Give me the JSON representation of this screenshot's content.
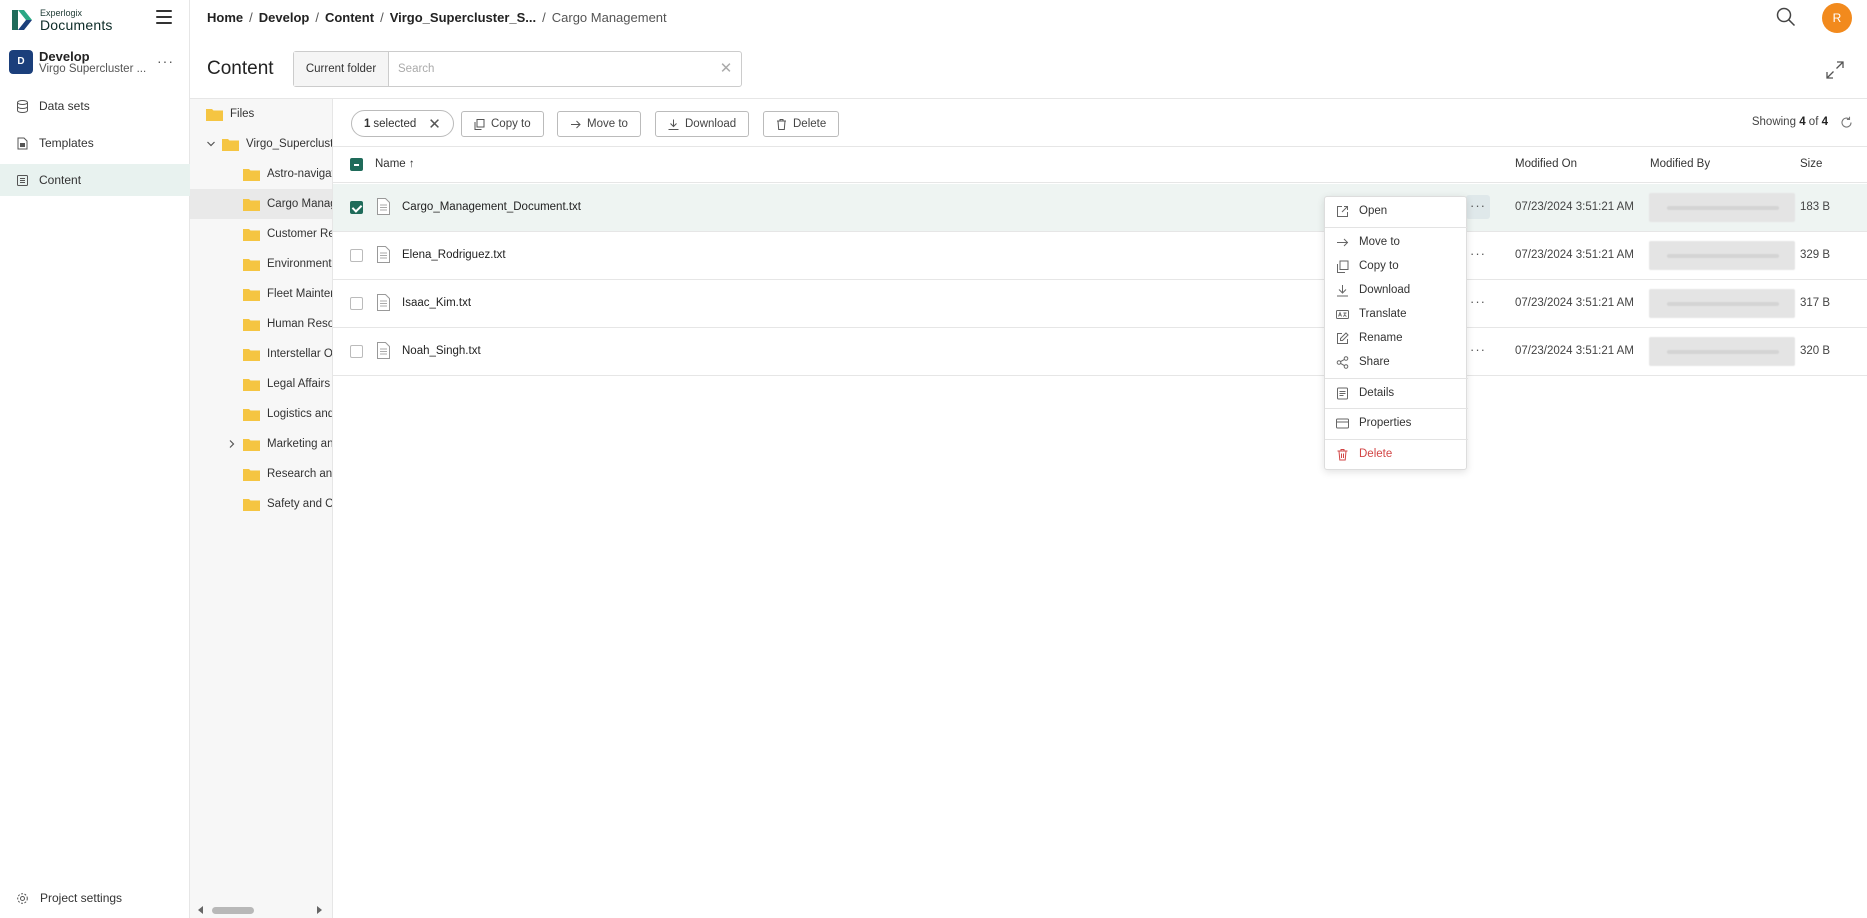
{
  "brand": {
    "small": "Experlogix",
    "big": "Documents",
    "color": "#0c2b27"
  },
  "project": {
    "avatar": "D",
    "name": "Develop",
    "sub": "Virgo Supercluster ...",
    "more": "···"
  },
  "nav": [
    {
      "label": "Data sets",
      "icon": "database-icon"
    },
    {
      "label": "Templates",
      "icon": "document-icon"
    },
    {
      "label": "Content",
      "icon": "content-icon",
      "active": true
    }
  ],
  "project_settings": "Project settings",
  "breadcrumb": [
    "Home",
    "Develop",
    "Content",
    "Virgo_Supercluster_S...",
    "Cargo Management"
  ],
  "user_avatar": "R",
  "page": {
    "title": "Content",
    "search_scope": "Current folder",
    "search_placeholder": "Search",
    "search_value": ""
  },
  "tree": {
    "root": "Files",
    "project_folder": "Virgo_Supercluster",
    "folders": [
      "Astro-navigation",
      "Cargo Management",
      "Customer Relations",
      "Environmental",
      "Fleet Maintenance",
      "Human Resources",
      "Interstellar Operations",
      "Legal Affairs",
      "Logistics and",
      "Marketing and",
      "Research and",
      "Safety and Compliance"
    ]
  },
  "toolbar": {
    "selected_count": "1",
    "selected_text": "selected",
    "copy_to": "Copy to",
    "move_to": "Move to",
    "download": "Download",
    "delete": "Delete",
    "showing_prefix": "Showing",
    "showing_count": "4",
    "showing_of": "of",
    "showing_total": "4"
  },
  "table": {
    "headers": {
      "name": "Name ↑",
      "modified_on": "Modified On",
      "modified_by": "Modified By",
      "size": "Size"
    },
    "rows": [
      {
        "name": "Cargo_Management_Document.txt",
        "modified_on": "07/23/2024 3:51:21 AM",
        "size": "183 B",
        "selected": true
      },
      {
        "name": "Elena_Rodriguez.txt",
        "modified_on": "07/23/2024 3:51:21 AM",
        "size": "329 B",
        "selected": false
      },
      {
        "name": "Isaac_Kim.txt",
        "modified_on": "07/23/2024 3:51:21 AM",
        "size": "317 B",
        "selected": false
      },
      {
        "name": "Noah_Singh.txt",
        "modified_on": "07/23/2024 3:51:21 AM",
        "size": "320 B",
        "selected": false
      }
    ]
  },
  "context_menu": {
    "open": "Open",
    "move_to": "Move to",
    "copy_to": "Copy to",
    "download": "Download",
    "translate": "Translate",
    "rename": "Rename",
    "share": "Share",
    "details": "Details",
    "properties": "Properties",
    "delete": "Delete"
  },
  "colors": {
    "accent": "#1f6b5a",
    "active_nav": "#e8f2ef",
    "avatar": "#f28a1d",
    "danger": "#d24545",
    "project_avatar": "#1b3f7b"
  }
}
